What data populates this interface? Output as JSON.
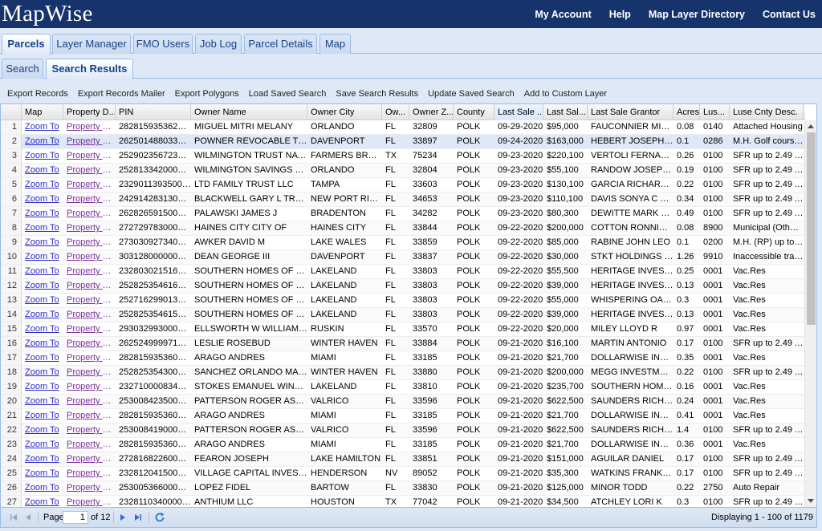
{
  "app": {
    "logo": "MapWise"
  },
  "topnav": [
    "My Account",
    "Help",
    "Map Layer Directory",
    "Contact Us"
  ],
  "main_tabs": [
    "Parcels",
    "Layer Manager",
    "FMO Users",
    "Job Log",
    "Parcel Details",
    "Map"
  ],
  "main_tab_active": "Parcels",
  "sub_tabs": [
    "Search",
    "Search Results"
  ],
  "sub_tab_active": "Search Results",
  "toolbar": [
    "Export Records",
    "Export Records Mailer",
    "Export Polygons",
    "Load Saved Search",
    "Save Search Results",
    "Update Saved Search",
    "Add to Custom Layer"
  ],
  "grid": {
    "columns": [
      "",
      "Map",
      "Property D...",
      "PIN",
      "Owner Name",
      "Owner City",
      "Ow...",
      "Owner Z...",
      "County",
      "Last Sale ...",
      "Last Sal...",
      "Last Sale Grantor",
      "Acres",
      "Lus...",
      "Luse Cnty Desc."
    ],
    "sorted_column": 9,
    "selected_row": 2,
    "rows": [
      [
        "1",
        "Zoom To",
        "Property D...",
        "28281593536200...",
        "MIGUEL MITRI MELANY",
        "ORLANDO",
        "FL",
        "32809",
        "POLK",
        "09-29-2020",
        "$95,000",
        "FAUCONNIER MIC...",
        "0.08",
        "0140",
        "Attached Housing"
      ],
      [
        "2",
        "Zoom To",
        "Property D...",
        "26250148803300...",
        "POWNER REVOCABLE TRUST",
        "DAVENPORT",
        "FL",
        "33897",
        "POLK",
        "09-24-2020",
        "$163,000",
        "HEBERT JOSEPH W",
        "0.1",
        "0286",
        "M.H. Golf course ..."
      ],
      [
        "3",
        "Zoom To",
        "Property D...",
        "25290235672300...",
        "WILMINGTON TRUST NATIO...",
        "FARMERS BRAN...",
        "TX",
        "75234",
        "POLK",
        "09-23-2020",
        "$220,100",
        "VERTOLI FERNAND...",
        "0.26",
        "0100",
        "SFR up to 2.49 AC"
      ],
      [
        "4",
        "Zoom To",
        "Property D...",
        "25281334200000...",
        "WILMINGTON SAVINGS FUN...",
        "ORLANDO",
        "FL",
        "32804",
        "POLK",
        "09-23-2020",
        "$55,100",
        "RANDOW JOSEPH ...",
        "0.19",
        "0100",
        "SFR up to 2.49 AC"
      ],
      [
        "5",
        "Zoom To",
        "Property D...",
        "23290113935000...",
        "LTD FAMILY TRUST LLC",
        "TAMPA",
        "FL",
        "33603",
        "POLK",
        "09-23-2020",
        "$130,100",
        "GARCIA RICHARD ...",
        "0.22",
        "0100",
        "SFR up to 2.49 AC"
      ],
      [
        "6",
        "Zoom To",
        "Property D...",
        "24291428313000...",
        "BLACKWELL GARY L TRUST",
        "NEW PORT RIC...",
        "FL",
        "34653",
        "POLK",
        "09-23-2020",
        "$110,100",
        "DAVIS SONYA C ET ...",
        "0.34",
        "0100",
        "SFR up to 2.49 AC"
      ],
      [
        "7",
        "Zoom To",
        "Property D...",
        "26282659150000...",
        "PALAWSKI JAMES J",
        "BRADENTON",
        "FL",
        "34282",
        "POLK",
        "09-23-2020",
        "$80,300",
        "DEWITTE MARK W ...",
        "0.49",
        "0100",
        "SFR up to 2.49 AC"
      ],
      [
        "8",
        "Zoom To",
        "Property D...",
        "27272978300000...",
        "HAINES CITY CITY OF",
        "HAINES CITY",
        "FL",
        "33844",
        "POLK",
        "09-22-2020",
        "$200,000",
        "COTTON RONNIE C",
        "0.08",
        "8900",
        "Municipal (Other t..."
      ],
      [
        "9",
        "Zoom To",
        "Property D...",
        "27303092734000...",
        "AWKER DAVID M",
        "LAKE WALES",
        "FL",
        "33859",
        "POLK",
        "09-22-2020",
        "$85,000",
        "RABINE JOHN LEO",
        "0.1",
        "0200",
        "M.H. (RP) up to 2..."
      ],
      [
        "10",
        "Zoom To",
        "Property D...",
        "30312800000002...",
        "DEAN GEORGE III",
        "DAVENPORT",
        "FL",
        "33837",
        "POLK",
        "09-22-2020",
        "$30,000",
        "STKT HOLDINGS LLC",
        "1.26",
        "9910",
        "Inaccessible tracts"
      ],
      [
        "11",
        "Zoom To",
        "Property D...",
        "23280302151600...",
        "SOUTHERN HOMES OF POL...",
        "LAKELAND",
        "FL",
        "33803",
        "POLK",
        "09-22-2020",
        "$55,500",
        "HERITAGE INVEST...",
        "0.25",
        "0001",
        "Vac.Res"
      ],
      [
        "12",
        "Zoom To",
        "Property D...",
        "25282535461600...",
        "SOUTHERN HOMES OF POL...",
        "LAKELAND",
        "FL",
        "33803",
        "POLK",
        "09-22-2020",
        "$39,000",
        "HERITAGE INVEST...",
        "0.13",
        "0001",
        "Vac.Res"
      ],
      [
        "13",
        "Zoom To",
        "Property D...",
        "25271629901300...",
        "SOUTHERN HOMES OF POL...",
        "LAKELAND",
        "FL",
        "33803",
        "POLK",
        "09-22-2020",
        "$55,000",
        "WHISPERING OAK...",
        "0.3",
        "0001",
        "Vac.Res"
      ],
      [
        "14",
        "Zoom To",
        "Property D...",
        "25282535461500...",
        "SOUTHERN HOMES OF POL...",
        "LAKELAND",
        "FL",
        "33803",
        "POLK",
        "09-22-2020",
        "$39,000",
        "HERITAGE INVEST...",
        "0.13",
        "0001",
        "Vac.Res"
      ],
      [
        "15",
        "Zoom To",
        "Property D...",
        "29303299300000...",
        "ELLSWORTH W WILLIAM III",
        "RUSKIN",
        "FL",
        "33570",
        "POLK",
        "09-22-2020",
        "$20,000",
        "MILEY LLOYD R",
        "0.97",
        "0001",
        "Vac.Res"
      ],
      [
        "16",
        "Zoom To",
        "Property D...",
        "26252499997100...",
        "LESLIE ROSEBUD",
        "WINTER HAVEN",
        "FL",
        "33884",
        "POLK",
        "09-21-2020",
        "$16,100",
        "MARTIN ANTONIO",
        "0.17",
        "0100",
        "SFR up to 2.49 AC"
      ],
      [
        "17",
        "Zoom To",
        "Property D...",
        "28281593536005...",
        "ARAGO ANDRES",
        "MIAMI",
        "FL",
        "33185",
        "POLK",
        "09-21-2020",
        "$21,700",
        "DOLLARWISE INSU...",
        "0.35",
        "0001",
        "Vac.Res"
      ],
      [
        "18",
        "Zoom To",
        "Property D...",
        "25282535430000...",
        "SANCHEZ ORLANDO MARIO",
        "WINTER HAVEN",
        "FL",
        "33880",
        "POLK",
        "09-21-2020",
        "$200,000",
        "MEGG INVESTMEN...",
        "0.22",
        "0100",
        "SFR up to 2.49 AC"
      ],
      [
        "19",
        "Zoom To",
        "Property D...",
        "23271000083400...",
        "STOKES EMANUEL WINSLOW",
        "LAKELAND",
        "FL",
        "33810",
        "POLK",
        "09-21-2020",
        "$235,700",
        "SOUTHERN HOME...",
        "0.16",
        "0001",
        "Vac.Res"
      ],
      [
        "20",
        "Zoom To",
        "Property D...",
        "25300842350000...",
        "PATTERSON ROGER ASHBR...",
        "VALRICO",
        "FL",
        "33596",
        "POLK",
        "09-21-2020",
        "$622,500",
        "SAUNDERS RICHA...",
        "0.24",
        "0001",
        "Vac.Res"
      ],
      [
        "21",
        "Zoom To",
        "Property D...",
        "28281593536005...",
        "ARAGO ANDRES",
        "MIAMI",
        "FL",
        "33185",
        "POLK",
        "09-21-2020",
        "$21,700",
        "DOLLARWISE INSU...",
        "0.41",
        "0001",
        "Vac.Res"
      ],
      [
        "22",
        "Zoom To",
        "Property D...",
        "25300841900000...",
        "PATTERSON ROGER ASHBR...",
        "VALRICO",
        "FL",
        "33596",
        "POLK",
        "09-21-2020",
        "$622,500",
        "SAUNDERS RICHA...",
        "1.4",
        "0100",
        "SFR up to 2.49 AC"
      ],
      [
        "23",
        "Zoom To",
        "Property D...",
        "28281593536005...",
        "ARAGO ANDRES",
        "MIAMI",
        "FL",
        "33185",
        "POLK",
        "09-21-2020",
        "$21,700",
        "DOLLARWISE INSU...",
        "0.36",
        "0001",
        "Vac.Res"
      ],
      [
        "24",
        "Zoom To",
        "Property D...",
        "27281682260000...",
        "FEARON JOSEPH",
        "LAKE HAMILTON",
        "FL",
        "33851",
        "POLK",
        "09-21-2020",
        "$151,000",
        "AGUILAR DANIEL",
        "0.17",
        "0100",
        "SFR up to 2.49 AC"
      ],
      [
        "25",
        "Zoom To",
        "Property D...",
        "23281204150000...",
        "VILLAGE CAPITAL INVESTM...",
        "HENDERSON",
        "NV",
        "89052",
        "POLK",
        "09-21-2020",
        "$35,300",
        "WATKINS FRANKLI...",
        "0.17",
        "0100",
        "SFR up to 2.49 AC"
      ],
      [
        "26",
        "Zoom To",
        "Property D...",
        "25300536600000...",
        "LOPEZ FIDEL",
        "BARTOW",
        "FL",
        "33830",
        "POLK",
        "09-21-2020",
        "$125,000",
        "MINOR TODD",
        "0.22",
        "2750",
        "Auto Repair"
      ],
      [
        "27",
        "Zoom To",
        "Property D...",
        "23281103400001...",
        "ANTHIUM LLC",
        "HOUSTON",
        "TX",
        "77042",
        "POLK",
        "09-21-2020",
        "$34,500",
        "ATCHLEY LORI K",
        "0.3",
        "0100",
        "SFR up to 2.49 AC"
      ]
    ]
  },
  "pager": {
    "page_label": "Page",
    "page_value": "1",
    "of_label": "of 12",
    "display_text": "Displaying 1 - 100 of 1179"
  },
  "colors": {
    "header_bg": "#16336c",
    "panel_bg": "#dfe8f6",
    "link": "#2a29c9",
    "visited_link": "#7b2d9b"
  }
}
